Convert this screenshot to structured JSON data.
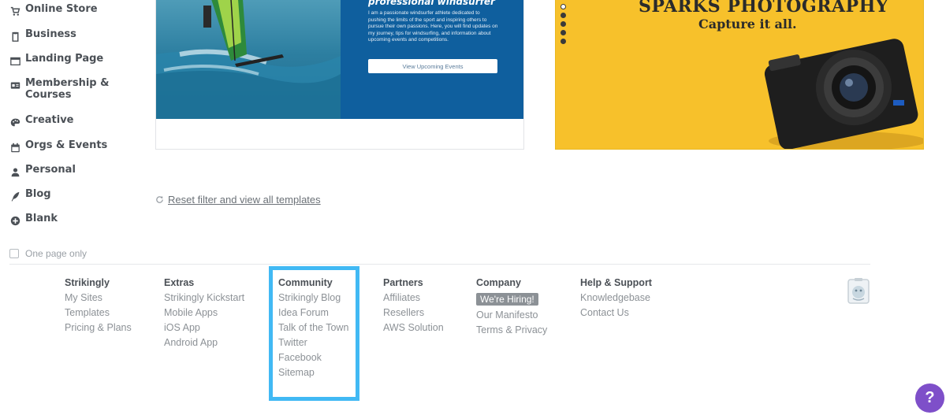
{
  "sidebar": {
    "items": [
      {
        "label": "Online Store",
        "icon": "cart-icon"
      },
      {
        "label": "Business",
        "icon": "clipboard-icon"
      },
      {
        "label": "Landing Page",
        "icon": "window-icon"
      },
      {
        "label": "Membership & Courses",
        "icon": "id-card-icon"
      },
      {
        "label": "Creative",
        "icon": "palette-icon"
      },
      {
        "label": "Orgs & Events",
        "icon": "calendar-icon"
      },
      {
        "label": "Personal",
        "icon": "user-icon"
      },
      {
        "label": "Blog",
        "icon": "quill-icon"
      },
      {
        "label": "Blank",
        "icon": "plus-circle-icon"
      }
    ],
    "one_page_only": "One page only"
  },
  "templates": {
    "left": {
      "heading": "professional windsurfer",
      "body": "I am a passionate windsurfer athlete dedicated to pushing the limits of the sport and inspiring others to pursue their own passions. Here, you will find updates on my journey, tips for windsurfing, and information about upcoming events and competitions.",
      "button": "View Upcoming Events"
    },
    "right": {
      "title": "SPARKS PHOTOGRAPHY",
      "subtitle": "Capture it all."
    }
  },
  "reset_link": "Reset filter and view all templates",
  "footer": {
    "columns": [
      {
        "heading": "Strikingly",
        "links": [
          "My Sites",
          "Templates",
          "Pricing & Plans"
        ]
      },
      {
        "heading": "Extras",
        "links": [
          "Strikingly Kickstart",
          "Mobile Apps",
          "iOS App",
          "Android App"
        ]
      },
      {
        "heading": "Community",
        "links": [
          "Strikingly Blog",
          "Idea Forum",
          "Talk of the Town",
          "Twitter",
          "Facebook",
          "Sitemap"
        ]
      },
      {
        "heading": "Partners",
        "links": [
          "Affiliates",
          "Resellers",
          "AWS Solution"
        ]
      },
      {
        "heading": "Company",
        "badge": "We're Hiring!",
        "links": [
          "Our Manifesto",
          "Terms & Privacy"
        ]
      },
      {
        "heading": "Help & Support",
        "links": [
          "Knowledgebase",
          "Contact Us"
        ]
      }
    ]
  },
  "help_button": "?",
  "colors": {
    "highlight": "#41b9f4",
    "help_button": "#7e4fc9",
    "photo_yellow": "#f7c12b",
    "panel_blue": "#0f5f9e"
  }
}
